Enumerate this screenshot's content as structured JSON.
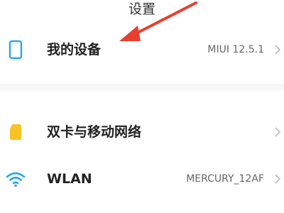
{
  "header": {
    "title": "设置"
  },
  "rows": [
    {
      "label": "我的设备",
      "value": "MIUI 12.5.1",
      "icon": "phone-device-icon"
    },
    {
      "label": "双卡与移动网络",
      "value": "",
      "icon": "sim-card-icon"
    },
    {
      "label": "WLAN",
      "value": "MERCURY_12AF",
      "icon": "wifi-icon"
    }
  ],
  "colors": {
    "accent_blue": "#2aa6e9",
    "sim_yellow": "#f7c325",
    "annotation_red": "#e8402f"
  }
}
